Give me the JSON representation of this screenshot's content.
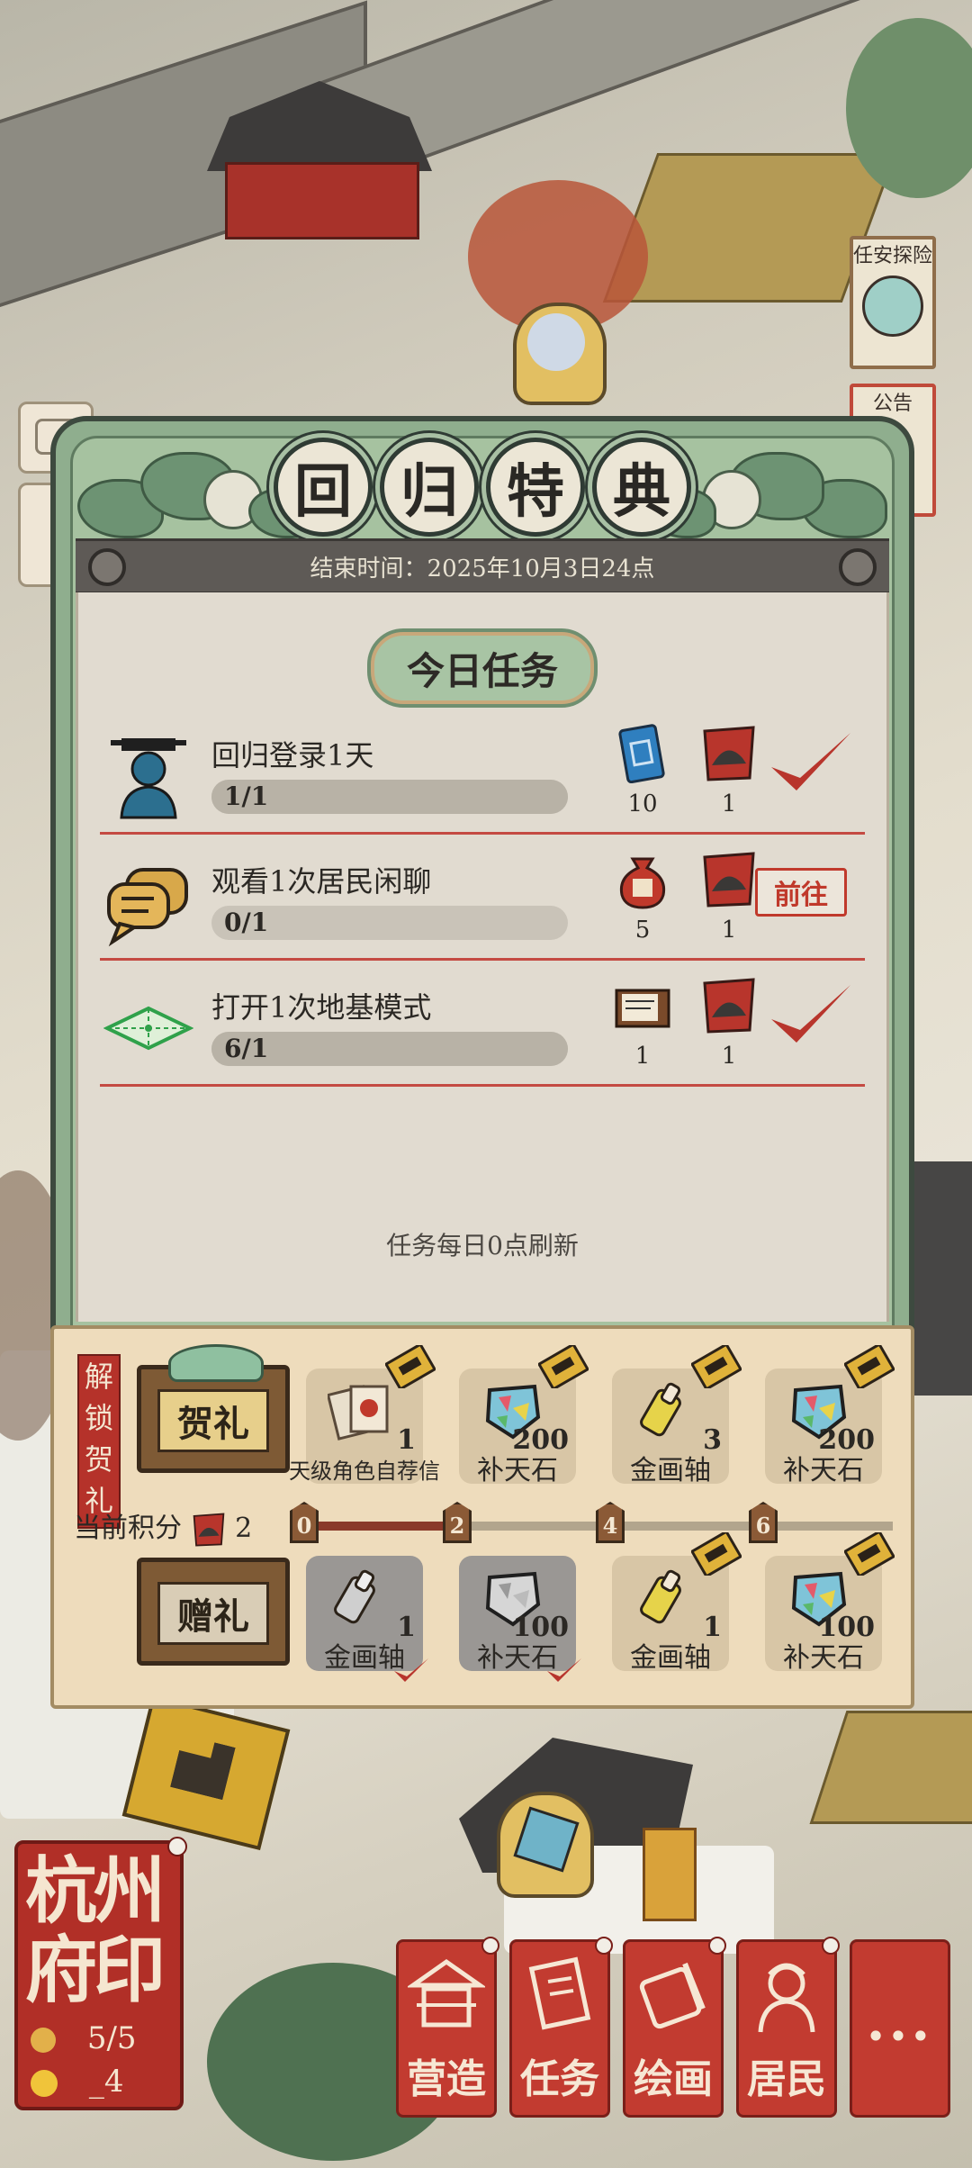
{
  "event": {
    "title_chars": [
      "回",
      "归",
      "特",
      "典"
    ],
    "end_time": "结束时间：2025年10月3日24点"
  },
  "today_tasks": {
    "header": "今日任务",
    "tasks": [
      {
        "icon": "official-icon",
        "name": "回归登录1天",
        "progress": "1/1",
        "progress_fraction": 1.0,
        "rewards": [
          {
            "icon": "ticket-icon",
            "count": "10"
          },
          {
            "icon": "hat-token-icon",
            "count": "1"
          }
        ],
        "status": "completed"
      },
      {
        "icon": "chat-icon",
        "name": "观看1次居民闲聊",
        "progress": "0/1",
        "progress_fraction": 0.0,
        "rewards": [
          {
            "icon": "pouch-icon",
            "count": "5"
          },
          {
            "icon": "hat-token-icon",
            "count": "1"
          }
        ],
        "status": "goto",
        "goto_label": "前往"
      },
      {
        "icon": "foundation-icon",
        "name": "打开1次地基模式",
        "progress": "6/1",
        "progress_fraction": 1.0,
        "rewards": [
          {
            "icon": "book-icon",
            "count": "1"
          },
          {
            "icon": "hat-token-icon",
            "count": "1"
          }
        ],
        "status": "completed"
      }
    ],
    "refresh_note": "任务每日0点刷新"
  },
  "rewards": {
    "unlock_label": "解锁贺礼",
    "premium_label": "贺礼",
    "free_label": "赠礼",
    "score_label": "当前积分",
    "score_value": "2",
    "milestones": [
      "0",
      "2",
      "4",
      "6"
    ],
    "premium_row": [
      {
        "icon": "letter-icon",
        "count": "1",
        "name": "天级角色自荐信",
        "locked": true
      },
      {
        "icon": "gem-stone-icon",
        "count": "200",
        "name": "补天石",
        "locked": true
      },
      {
        "icon": "scroll-icon",
        "count": "3",
        "name": "金画轴",
        "locked": true
      },
      {
        "icon": "gem-stone-icon",
        "count": "200",
        "name": "补天石",
        "locked": true
      }
    ],
    "free_row": [
      {
        "icon": "scroll-icon",
        "count": "1",
        "name": "金画轴",
        "claimed": true
      },
      {
        "icon": "gem-stone-icon",
        "count": "100",
        "name": "补天石",
        "claimed": true
      },
      {
        "icon": "scroll-icon",
        "count": "1",
        "name": "金画轴",
        "locked": true
      },
      {
        "icon": "gem-stone-icon",
        "count": "100",
        "name": "补天石",
        "locked": true
      }
    ]
  },
  "side_notices": [
    "任安探险",
    "公告"
  ],
  "city_seal": {
    "name": "杭州府印",
    "residents": "5/5",
    "level": "_4"
  },
  "bottom_nav": [
    {
      "label": "营造",
      "icon": "pavilion-icon"
    },
    {
      "label": "任务",
      "icon": "task-book-icon"
    },
    {
      "label": "绘画",
      "icon": "brush-scroll-icon"
    },
    {
      "label": "居民",
      "icon": "resident-icon"
    },
    {
      "label": "···",
      "icon": "more-icon"
    }
  ]
}
